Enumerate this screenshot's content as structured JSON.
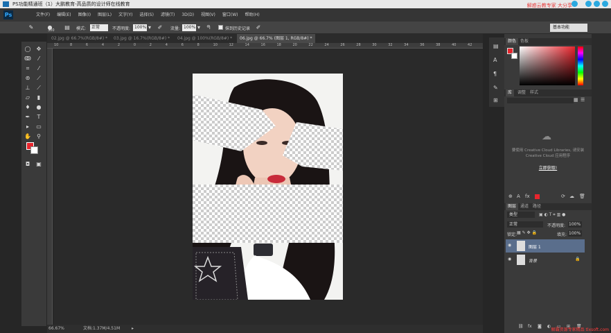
{
  "window": {
    "title": "PS功能精通班（1）大鹏教育-高品质的设计师在线教育",
    "brand_text": "解惑云教专家 大分享"
  },
  "menubar": {
    "logo": "Ps",
    "items": [
      "文件(F)",
      "编辑(E)",
      "图像(I)",
      "图层(L)",
      "文字(Y)",
      "选择(S)",
      "滤镜(T)",
      "3D(D)",
      "视图(V)",
      "窗口(W)",
      "帮助(H)"
    ]
  },
  "options": {
    "brush_size": "300",
    "mode_label": "模式:",
    "mode_value": "正常",
    "opacity_label": "不透明度:",
    "opacity_value": "100%",
    "flow_label": "流量:",
    "flow_value": "100%",
    "history_label": "抹到历史记录",
    "preset": "基本功能"
  },
  "tabs": [
    {
      "label": "02.jpg @ 66.7%(RGB/8#) *",
      "active": false
    },
    {
      "label": "03.jpg @ 16.7%(RGB/8#) *",
      "active": false
    },
    {
      "label": "04.jpg @ 100%(RGB/8#) *",
      "active": false
    },
    {
      "label": "06.jpg @ 66.7% (图层 1, RGB/8#) *",
      "active": true
    }
  ],
  "ruler_top": [
    "10",
    "8",
    "6",
    "4",
    "2",
    "0",
    "2",
    "4",
    "6",
    "8",
    "10",
    "12",
    "14",
    "16",
    "18",
    "20",
    "22",
    "24",
    "26",
    "28",
    "30",
    "32",
    "34",
    "36",
    "38",
    "40",
    "42"
  ],
  "status": {
    "zoom": "66.67%",
    "doc": "文档:1.37M/4.51M"
  },
  "color_panel": {
    "tabs": [
      "颜色",
      "色板"
    ],
    "fg_color": "#e8252d",
    "bg_color": "#ffffff"
  },
  "library_panel": {
    "tabs": [
      "库",
      "调整",
      "样式"
    ],
    "message": "要使用 Creative Cloud Libraries, 请安装 Creative Cloud 应用程序",
    "link": "立即获取!"
  },
  "layers_panel": {
    "tabs": [
      "图层",
      "通道",
      "路径"
    ],
    "filter": "类型",
    "blend_mode": "正常",
    "opacity_label": "不透明度:",
    "opacity_value": "100%",
    "lock_label": "锁定:",
    "fill_label": "填充:",
    "fill_value": "100%",
    "layers": [
      {
        "name": "图层 1",
        "selected": true
      },
      {
        "name": "背景",
        "selected": false
      }
    ]
  },
  "watermark": "解霸资源专家精品 tlxsoft.com"
}
